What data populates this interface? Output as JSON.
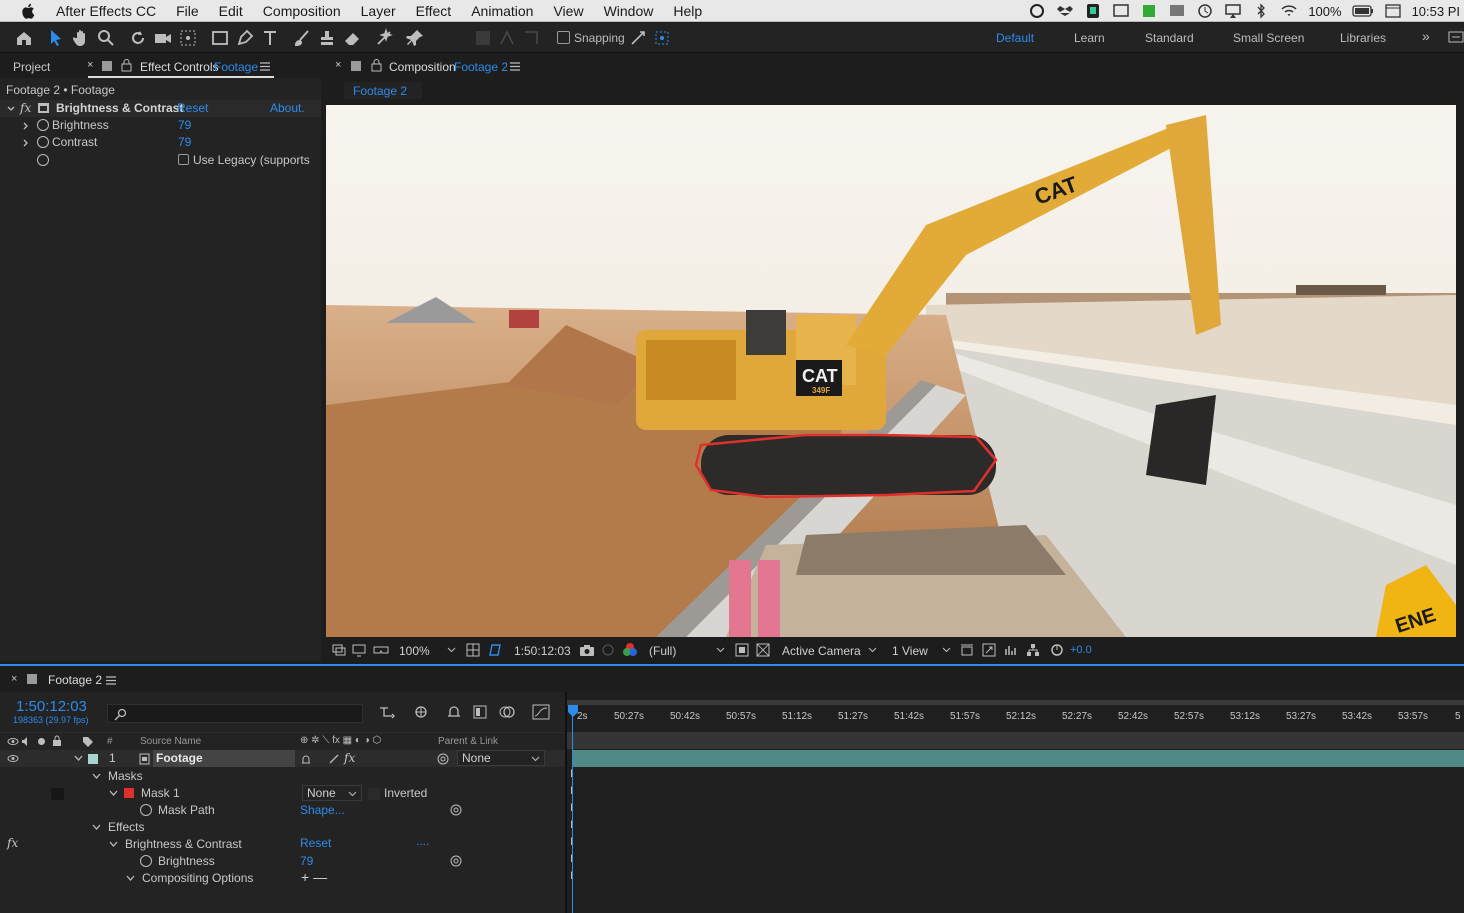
{
  "menubar": {
    "app": "After Effects CC",
    "items": [
      "File",
      "Edit",
      "Composition",
      "Layer",
      "Effect",
      "Animation",
      "View",
      "Window",
      "Help"
    ],
    "battery": "100%",
    "clock": "10:53 PI"
  },
  "toolbar": {
    "snapping_label": "Snapping",
    "workspaces": [
      "Default",
      "Learn",
      "Standard",
      "Small Screen",
      "Libraries"
    ],
    "active_workspace": "Default"
  },
  "left_panel": {
    "tab_project": "Project",
    "tab_effect_controls_prefix": "Effect Controls",
    "tab_effect_controls_layer": "Footage",
    "breadcrumb": "Footage 2 • Footage",
    "effect_name": "Brightness & Contrast",
    "reset_label": "Reset",
    "about_label": "About.",
    "brightness_label": "Brightness",
    "brightness_value": "79",
    "contrast_label": "Contrast",
    "contrast_value": "79",
    "legacy_label": "Use Legacy (supports"
  },
  "comp_panel": {
    "tab_prefix": "Composition",
    "tab_name": "Footage 2",
    "subtab": "Footage 2",
    "viewer_image": {
      "stamps": [
        "CAT",
        "CAT",
        "349F",
        "ENE"
      ]
    },
    "bottom": {
      "zoom": "100%",
      "timecode": "1:50:12:03",
      "resolution": "(Full)",
      "camera": "Active Camera",
      "views": "1 View",
      "exposure": "+0.0"
    }
  },
  "timeline": {
    "tab": "Footage 2",
    "timecode": "1:50:12:03",
    "frame_info": "198363 (29.97 fps)",
    "search_placeholder": "",
    "col_hash": "#",
    "col_source": "Source Name",
    "col_parent": "Parent & Link",
    "ruler": [
      "2s",
      "50:27s",
      "50:42s",
      "50:57s",
      "51:12s",
      "51:27s",
      "51:42s",
      "51:57s",
      "52:12s",
      "52:27s",
      "52:42s",
      "52:57s",
      "53:12s",
      "53:27s",
      "53:42s",
      "53:57s",
      "5"
    ],
    "layer": {
      "num": "1",
      "name": "Footage",
      "parent": "None"
    },
    "masks_label": "Masks",
    "mask1_label": "Mask 1",
    "mask1_mode": "None",
    "inverted_label": "Inverted",
    "mask_path_label": "Mask Path",
    "mask_path_value": "Shape...",
    "effects_label": "Effects",
    "effect_label": "Brightness & Contrast",
    "effect_reset": "Reset",
    "effect_dots": "....",
    "brightness_label": "Brightness",
    "brightness_value": "79",
    "compositing_label": "Compositing Options",
    "compositing_controls": "+ —"
  },
  "colors": {
    "accent": "#2d8ceb",
    "mask_red": "#e0302b",
    "layer_label": "#a8d5cf",
    "track_bar": "#4f8a86"
  }
}
